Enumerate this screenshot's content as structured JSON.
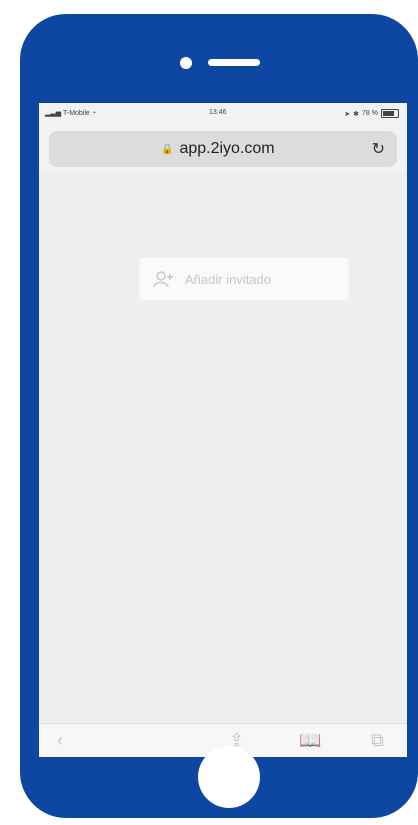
{
  "status_bar": {
    "carrier": "T-Mobile",
    "time": "13:46",
    "battery": "78 %",
    "battery_level": 0.78
  },
  "browser": {
    "url": "app.2iyo.com"
  },
  "page": {
    "add_guest_label": "Añadir invitado"
  },
  "colors": {
    "phone_frame": "#0d47a1",
    "screen_bg": "#f2f2f2"
  },
  "icons": {
    "lock": "lock-icon",
    "reload": "reload-icon",
    "add_user": "add-user-icon",
    "back": "chevron-left-icon",
    "share": "share-icon",
    "bookmarks": "book-icon",
    "tabs": "tabs-icon"
  }
}
